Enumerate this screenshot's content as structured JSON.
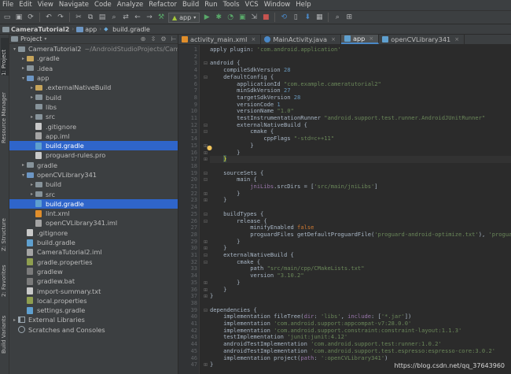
{
  "menu": [
    "File",
    "Edit",
    "View",
    "Navigate",
    "Code",
    "Analyze",
    "Refactor",
    "Build",
    "Run",
    "Tools",
    "VCS",
    "Window",
    "Help"
  ],
  "toolbar": {
    "run_config": "app",
    "icons": [
      "open-folder-icon",
      "save-icon",
      "sync-icon",
      "undo-icon",
      "redo-icon",
      "cut-icon",
      "copy-icon",
      "paste-icon",
      "find-icon",
      "replace-icon",
      "back-icon",
      "forward-icon",
      "make-icon",
      "run-icon",
      "debug-icon",
      "profile-icon",
      "coverage-icon",
      "attach-icon",
      "stop-icon",
      "sync-gradle-icon",
      "avd-manager-icon",
      "sdk-manager-icon",
      "device-icon",
      "search-everywhere-icon",
      "layout-inspector-icon"
    ]
  },
  "breadcrumb": [
    "CameraTutorial2",
    "app",
    "build.gradle"
  ],
  "left_strip": [
    "1: Project",
    "Resource Manager",
    "Z: Structure",
    "2: Favorites",
    "Build Variants"
  ],
  "project_panel": {
    "title": "Project",
    "tree": [
      {
        "indent": 0,
        "arrow": "▾",
        "icon": "folder",
        "label": "CameraTutorial2",
        "hint": "~/AndroidStudioProjects/Camer"
      },
      {
        "indent": 1,
        "arrow": "▸",
        "icon": "folder-orange",
        "label": ".gradle"
      },
      {
        "indent": 1,
        "arrow": "▸",
        "icon": "folder",
        "label": ".idea"
      },
      {
        "indent": 1,
        "arrow": "▾",
        "icon": "folder-blue",
        "label": "app"
      },
      {
        "indent": 2,
        "arrow": "▸",
        "icon": "folder-orange",
        "label": ".externalNativeBuild"
      },
      {
        "indent": 2,
        "arrow": "▸",
        "icon": "folder",
        "label": "build"
      },
      {
        "indent": 2,
        "arrow": "",
        "icon": "folder",
        "label": "libs"
      },
      {
        "indent": 2,
        "arrow": "▸",
        "icon": "folder",
        "label": "src"
      },
      {
        "indent": 2,
        "arrow": "",
        "icon": "file-txt",
        "label": ".gitignore"
      },
      {
        "indent": 2,
        "arrow": "",
        "icon": "file-iml",
        "label": "app.iml"
      },
      {
        "indent": 2,
        "arrow": "",
        "icon": "file-gradle",
        "label": "build.gradle",
        "selected": true
      },
      {
        "indent": 2,
        "arrow": "",
        "icon": "file-txt",
        "label": "proguard-rules.pro"
      },
      {
        "indent": 1,
        "arrow": "▸",
        "icon": "folder",
        "label": "gradle"
      },
      {
        "indent": 1,
        "arrow": "▾",
        "icon": "folder-blue",
        "label": "openCVLibrary341"
      },
      {
        "indent": 2,
        "arrow": "▸",
        "icon": "folder",
        "label": "build"
      },
      {
        "indent": 2,
        "arrow": "▸",
        "icon": "folder",
        "label": "src"
      },
      {
        "indent": 2,
        "arrow": "",
        "icon": "file-gradle",
        "label": "build.gradle",
        "selected": true
      },
      {
        "indent": 2,
        "arrow": "",
        "icon": "file-xml",
        "label": "lint.xml"
      },
      {
        "indent": 2,
        "arrow": "",
        "icon": "file-iml",
        "label": "openCVLibrary341.iml"
      },
      {
        "indent": 1,
        "arrow": "",
        "icon": "file-txt",
        "label": ".gitignore"
      },
      {
        "indent": 1,
        "arrow": "",
        "icon": "file-gradle",
        "label": "build.gradle"
      },
      {
        "indent": 1,
        "arrow": "",
        "icon": "file-iml",
        "label": "CameraTutorial2.iml"
      },
      {
        "indent": 1,
        "arrow": "",
        "icon": "file-prop",
        "label": "gradle.properties"
      },
      {
        "indent": 1,
        "arrow": "",
        "icon": "file-bat",
        "label": "gradlew"
      },
      {
        "indent": 1,
        "arrow": "",
        "icon": "file-bat",
        "label": "gradlew.bat"
      },
      {
        "indent": 1,
        "arrow": "",
        "icon": "file-txt",
        "label": "import-summary.txt"
      },
      {
        "indent": 1,
        "arrow": "",
        "icon": "file-prop",
        "label": "local.properties"
      },
      {
        "indent": 1,
        "arrow": "",
        "icon": "file-gradle",
        "label": "settings.gradle"
      },
      {
        "indent": 0,
        "arrow": "▸",
        "icon": "library",
        "label": "External Libraries"
      },
      {
        "indent": 0,
        "arrow": "",
        "icon": "scratch",
        "label": "Scratches and Consoles"
      }
    ]
  },
  "tabs": [
    {
      "label": "activity_main.xml",
      "icon": "xml",
      "active": false
    },
    {
      "label": "MainActivity.java",
      "icon": "java",
      "active": false
    },
    {
      "label": "app",
      "icon": "gradle",
      "active": true
    },
    {
      "label": "openCVLibrary341",
      "icon": "gradle",
      "active": false
    }
  ],
  "editor": {
    "current_line": 17,
    "lines": [
      "apply plugin: 'com.android.application'",
      "",
      "android {",
      "    compileSdkVersion 28",
      "    defaultConfig {",
      "        applicationId \"com.example.cameratutorial2\"",
      "        minSdkVersion 27",
      "        targetSdkVersion 28",
      "        versionCode 1",
      "        versionName \"1.0\"",
      "        testInstrumentationRunner \"android.support.test.runner.AndroidJUnitRunner\"",
      "        externalNativeBuild {",
      "            cmake {",
      "                cppFlags \"-std=c++11\"",
      "            }",
      "        }",
      "    }",
      "",
      "    sourceSets {",
      "        main {",
      "            jniLibs.srcDirs = ['src/main/jniLibs']",
      "        }",
      "    }",
      "",
      "    buildTypes {",
      "        release {",
      "            minifyEnabled false",
      "            proguardFiles getDefaultProguardFile('proguard-android-optimize.txt'), 'proguard-rules.p",
      "        }",
      "    }",
      "    externalNativeBuild {",
      "        cmake {",
      "            path \"src/main/cpp/CMakeLists.txt\"",
      "            version \"3.10.2\"",
      "        }",
      "    }",
      "}",
      "",
      "dependencies {",
      "    implementation fileTree(dir: 'libs', include: ['*.jar'])",
      "    implementation 'com.android.support:appcompat-v7:28.0.0'",
      "    implementation 'com.android.support.constraint:constraint-layout:1.1.3'",
      "    testImplementation 'junit:junit:4.12'",
      "    androidTestImplementation 'com.android.support.test:runner:1.0.2'",
      "    androidTestImplementation 'com.android.support.test.espresso:espresso-core:3.0.2'",
      "    implementation project(path: ':openCVLibrary341')",
      "}"
    ]
  },
  "watermark": "https://blog.csdn.net/qq_37643960"
}
